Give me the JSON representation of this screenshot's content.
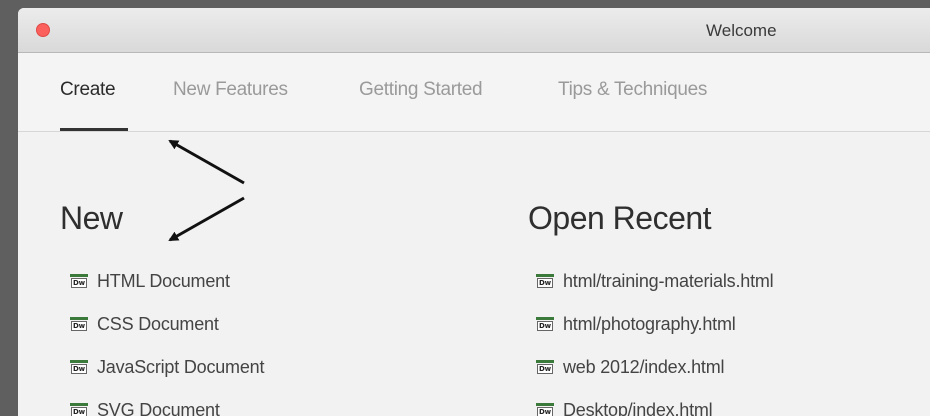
{
  "window": {
    "title": "Welcome"
  },
  "tabs": [
    {
      "label": "Create",
      "active": true
    },
    {
      "label": "New Features",
      "active": false
    },
    {
      "label": "Getting Started",
      "active": false
    },
    {
      "label": "Tips & Techniques",
      "active": false
    }
  ],
  "new_section": {
    "heading": "New",
    "items": [
      {
        "label": "HTML Document",
        "icon": "dw-file-icon"
      },
      {
        "label": "CSS Document",
        "icon": "dw-file-icon"
      },
      {
        "label": "JavaScript Document",
        "icon": "dw-file-icon"
      },
      {
        "label": "SVG Document",
        "icon": "dw-file-icon"
      }
    ]
  },
  "recent_section": {
    "heading": "Open Recent",
    "items": [
      {
        "label": "html/training-materials.html",
        "icon": "dw-file-icon"
      },
      {
        "label": "html/photography.html",
        "icon": "dw-file-icon"
      },
      {
        "label": "web 2012/index.html",
        "icon": "dw-file-icon"
      },
      {
        "label": "Desktop/index.html",
        "icon": "dw-file-icon"
      }
    ]
  },
  "icon_text": "Dw",
  "colors": {
    "close_button": "#fc605c",
    "icon_bar": "#3c7a3c",
    "active_tab": "#2b2b2b",
    "inactive_tab": "#9a9a9a"
  }
}
